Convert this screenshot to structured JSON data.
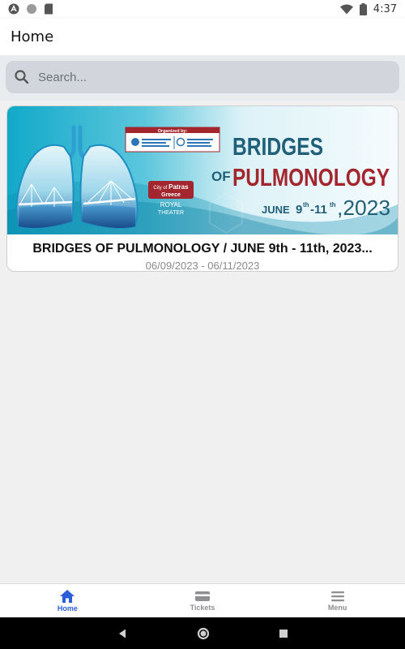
{
  "status_bar": {
    "time": "4:37"
  },
  "app_bar": {
    "title": "Home"
  },
  "search": {
    "placeholder": "Search..."
  },
  "events": [
    {
      "title": "BRIDGES OF PULMONOLOGY / JUNE 9th - 11th, 2023...",
      "dates": "06/09/2023 - 06/11/2023",
      "banner": {
        "organized_by": "Organized by:",
        "headline_1": "BRIDGES",
        "headline_of": "OF",
        "headline_2": "PULMONOLOGY",
        "city_label": "City of",
        "city_name": "Patras",
        "country": "Greece",
        "venue_1": "ROYAL",
        "venue_2": "THEATER",
        "date_month": "JUNE",
        "date_day_1": "9",
        "date_sup_1": "th",
        "date_dash": "-11",
        "date_sup_2": "th",
        "date_year": ",2023"
      }
    }
  ],
  "bottom_nav": {
    "home": "Home",
    "tickets": "Tickets",
    "menu": "Menu"
  },
  "colors": {
    "accent": "#2b5fd9",
    "banner_red": "#a3262e",
    "banner_teal": "#1f5f78"
  }
}
